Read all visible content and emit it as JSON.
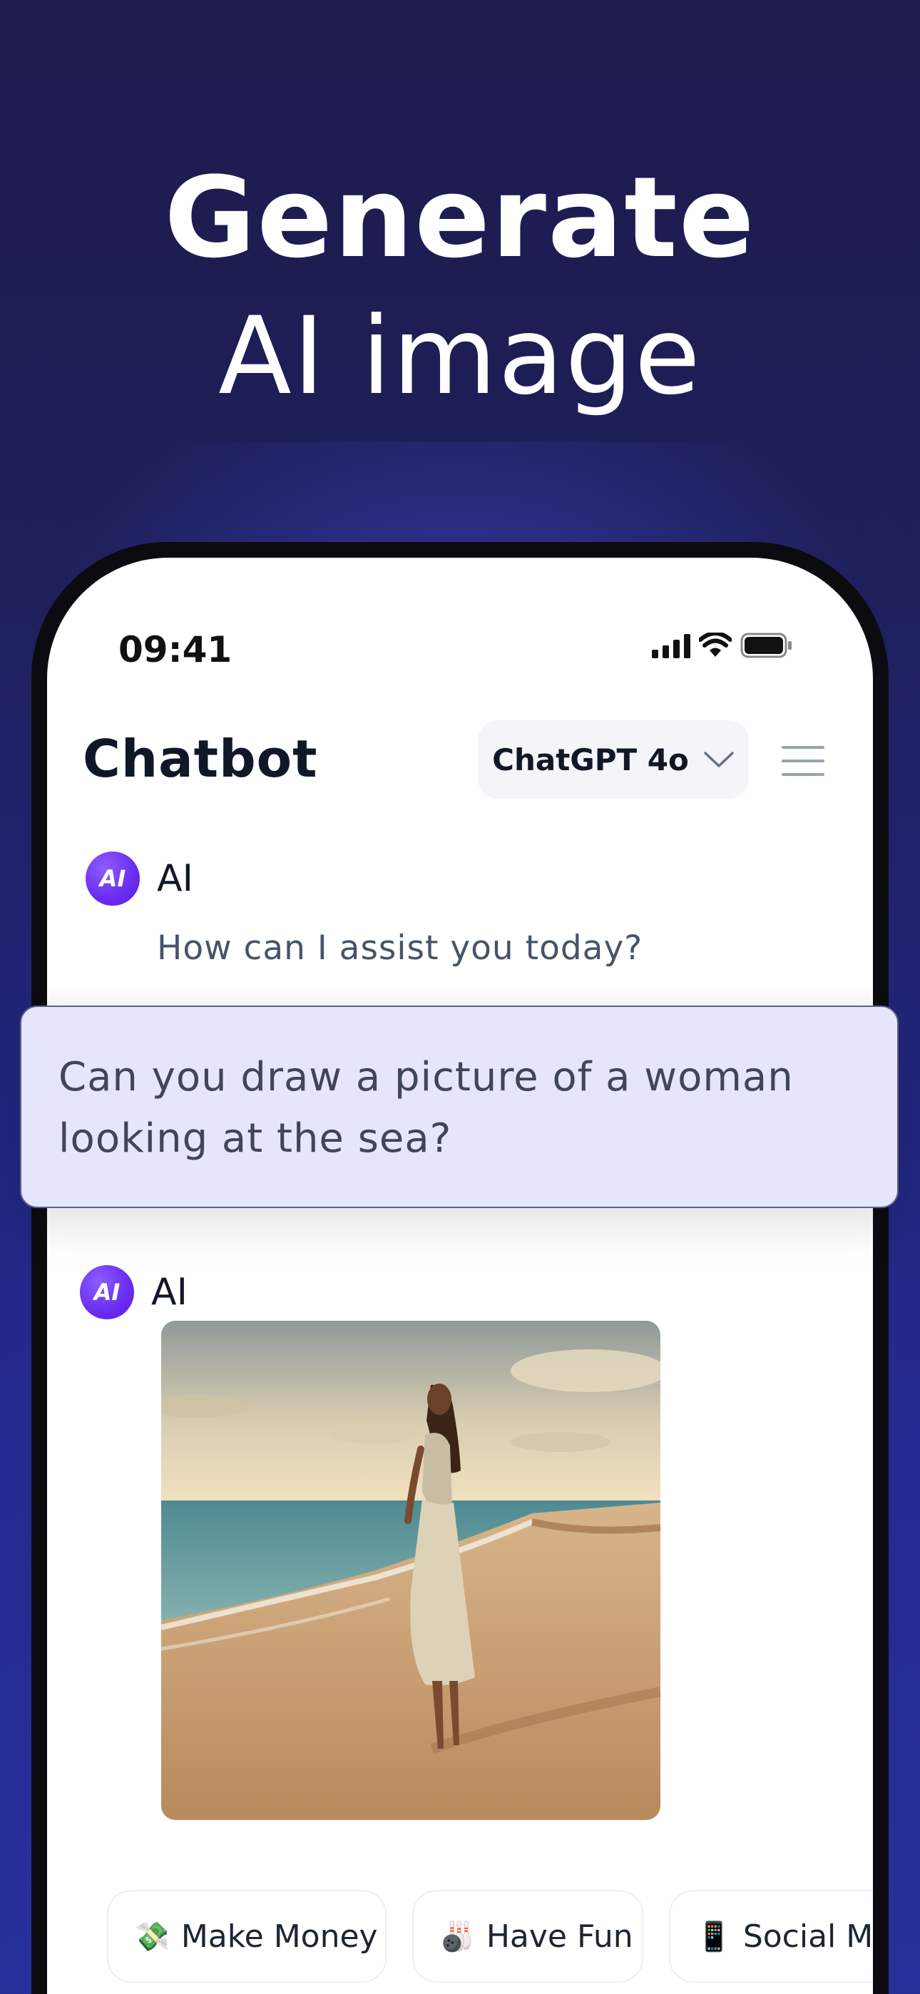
{
  "hero": {
    "line1": "Generate",
    "line2": "AI image"
  },
  "status_bar": {
    "time": "09:41",
    "icons": [
      "signal-icon",
      "wifi-icon",
      "battery-icon"
    ]
  },
  "header": {
    "title": "Chatbot",
    "model": "ChatGPT 4o",
    "icons": [
      "chevron-down-icon",
      "menu-icon"
    ]
  },
  "conversation": [
    {
      "sender": "AI",
      "avatar_text": "AI",
      "text": "How can I assist you today?"
    },
    {
      "sender": "user",
      "text": "Can you draw a picture of a woman looking at the sea?"
    },
    {
      "sender": "AI",
      "avatar_text": "AI",
      "content": "image",
      "image_subject": "woman-at-sea-image"
    }
  ],
  "suggestions": [
    {
      "emoji": "💸",
      "label": "Make Money"
    },
    {
      "emoji": "🎳",
      "label": "Have Fun"
    },
    {
      "emoji": "📱",
      "label": "Social Med"
    }
  ],
  "colors": {
    "background": "#1f1f5c",
    "accent": "#6a2cf0",
    "user_bubble": "#e5e6fc",
    "text_dark": "#101828"
  }
}
